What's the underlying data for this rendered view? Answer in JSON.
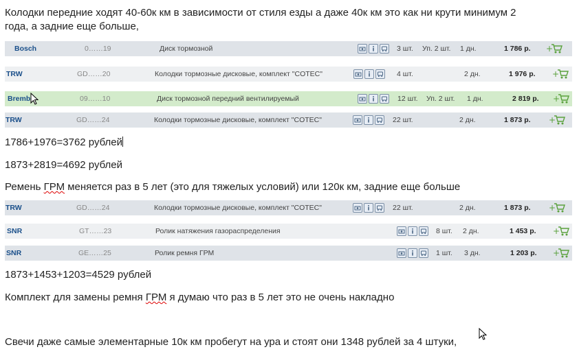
{
  "paragraphs": {
    "p1_line1": "Колодки передние ходят 40-60к км в зависимости от стиля езды а даже 40к км это как ни крути минимум 2",
    "p1_line2": "года, а задние еще больше,",
    "sum1": "1786+1976=3762 рублей",
    "sum2": "1873+2819=4692 рублей",
    "p2_before": "Ремень ",
    "p2_ul": "ГРМ",
    "p2_after": " меняется раз в 5 лет (это для тяжелых условий) или 120к км, задние еще больше",
    "sum3": "1873+1453+1203=4529 рублей",
    "p3_before": "Комплект для замены ремня ",
    "p3_ul": "ГРМ",
    "p3_after": " я думаю что раз в 5 лет это не очень накладно",
    "p4": "Свечи даже самые элементарные 10к км пробегут на ура и стоят они 1348 рублей за 4 штуки,"
  },
  "rows1": [
    {
      "brand": "Bosch",
      "code": "0……19",
      "name": "Диск тормозной",
      "qty": "3 шт.",
      "pack": "Уп. 2 шт.",
      "days": "1 дн.",
      "price": "1 786 р."
    },
    {
      "brand": "TRW",
      "code": "GD……20",
      "name": "Колодки тормозные дисковые, комплект \"COTEC\"",
      "qty": "4 шт.",
      "pack": "",
      "days": "2 дн.",
      "price": "1 976 р."
    },
    {
      "brand": "Brembo",
      "code": "09……10",
      "name": "Диск тормозной передний вентилируемый",
      "qty": "12 шт.",
      "pack": "Уп. 2 шт.",
      "days": "1 дн.",
      "price": "2 819 р."
    },
    {
      "brand": "TRW",
      "code": "GD……24",
      "name": "Колодки тормозные дисковые, комплект \"COTEC\"",
      "qty": "22 шт.",
      "pack": "",
      "days": "2 дн.",
      "price": "1 873 р."
    }
  ],
  "rows2": [
    {
      "brand": "TRW",
      "code": "GD……24",
      "name": "Колодки тормозные дисковые, комплект \"COTEC\"",
      "qty": "22 шт.",
      "pack": "",
      "days": "2 дн.",
      "price": "1 873 р."
    },
    {
      "brand": "SNR",
      "code": "GT……23",
      "name": "Ролик натяжения газораспределения",
      "qty": "8 шт.",
      "pack": "",
      "days": "2 дн.",
      "price": "1 453 р."
    },
    {
      "brand": "SNR",
      "code": "GE……25",
      "name": "Ролик ремня ГРМ",
      "qty": "1 шт.",
      "pack": "",
      "days": "3 дн.",
      "price": "1 203 р."
    }
  ],
  "colors": {
    "row_gray": "#dfe3e8",
    "row_light": "#eef0f2",
    "row_green": "#d3ebcb",
    "accent": "#5aa13c"
  },
  "icons": [
    "camera-icon",
    "info-icon",
    "car-icon",
    "add-to-cart-icon"
  ]
}
